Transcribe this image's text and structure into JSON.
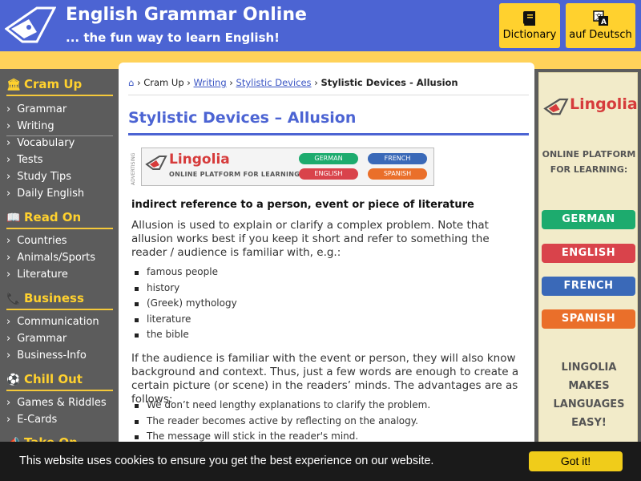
{
  "header": {
    "title": "English Grammar Online",
    "tagline": "... the fun way to learn English!",
    "dictionary_label": "Dictionary",
    "deutsch_label": "auf Deutsch"
  },
  "sidebar": {
    "sections": [
      {
        "title": "Cram Up",
        "icon": "bank-icon",
        "items": [
          "Grammar",
          "Writing",
          "Vocabulary",
          "Tests",
          "Study Tips",
          "Daily English"
        ]
      },
      {
        "title": "Read On",
        "icon": "book-icon",
        "items": [
          "Countries",
          "Animals/Sports",
          "Literature"
        ]
      },
      {
        "title": "Business",
        "icon": "phone-icon",
        "items": [
          "Communication",
          "Grammar",
          "Business-Info"
        ]
      },
      {
        "title": "Chill Out",
        "icon": "soccer-ball-icon",
        "items": [
          "Games & Riddles",
          "E-Cards"
        ]
      },
      {
        "title": "Take On",
        "icon": "megaphone-icon",
        "items": []
      }
    ]
  },
  "breadcrumb": {
    "home_icon": "home-icon",
    "items": [
      "Cram Up",
      "Writing",
      "Stylistic Devices",
      "Stylistic Devices - Allusion"
    ]
  },
  "main": {
    "title": "Stylistic Devices – Allusion",
    "ad": {
      "label": "ADVERTISING",
      "brand": "Lingolia",
      "subtitle": "ONLINE PLATFORM FOR LEARNING",
      "buttons": [
        "GERMAN",
        "FRENCH",
        "ENGLISH",
        "SPANISH"
      ]
    },
    "subtitle": "indirect reference to a person, event or piece of literature",
    "intro": "Allusion is used to explain or clarify a complex problem. Note that allusion works best if you keep it short and refer to something the reader / audience is familiar with, e.g.:",
    "examples": [
      "famous people",
      "history",
      "(Greek) mythology",
      "literature",
      "the bible"
    ],
    "para2": "If the audience is familiar with the event or person, they will also know background and context. Thus, just a few words are enough to create a certain picture (or scene) in the readers’ minds. The advantages are as follows:",
    "advantages": [
      "We don’t need lengthy explanations to clarify the problem.",
      "The reader becomes active by reflecting on the analogy.",
      "The message will stick in the reader's mind."
    ]
  },
  "right_ad": {
    "brand": "Lingolia",
    "tagline_line1": "ONLINE PLATFORM",
    "tagline_line2": "FOR LEARNING:",
    "buttons": [
      "GERMAN",
      "ENGLISH",
      "FRENCH",
      "SPANISH"
    ],
    "slogan": [
      "LINGOLIA",
      "MAKES",
      "LANGUAGES",
      "EASY!"
    ]
  },
  "cookie": {
    "text": "This website uses cookies to ensure you get the best experience on our website.",
    "button": "Got it!"
  },
  "colors": {
    "header_blue": "#4c64d3",
    "accent_yellow": "#ffd12e",
    "german": "#1dab6e",
    "english": "#d9434b",
    "french": "#3a69b8",
    "spanish": "#ea6f2a"
  }
}
